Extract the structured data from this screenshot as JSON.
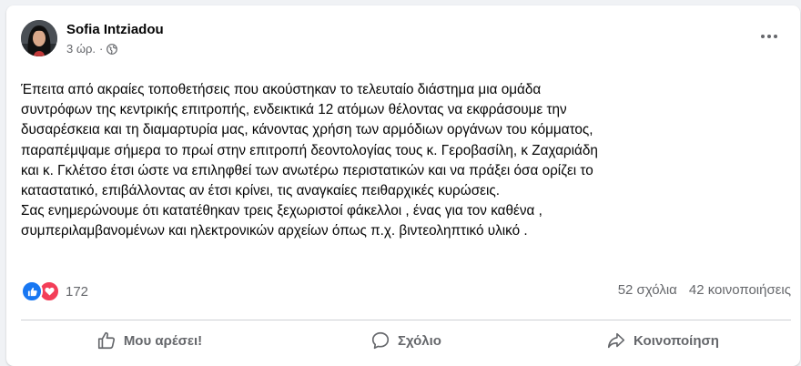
{
  "post": {
    "author": "Sofia Intziadou",
    "time": "3 ώρ.",
    "separator": "·",
    "audience_icon": "globe-icon",
    "body_lines": [
      "Έπειτα από ακραίες τοποθετήσεις που ακούστηκαν το τελευταίο διάστημα μια ομάδα",
      "συντρόφων της κεντρικής επιτροπής, ενδεικτικά 12 ατόμων θέλοντας να εκφράσουμε την",
      "δυσαρέσκεια και τη διαμαρτυρία μας, κάνοντας χρήση των αρμόδιων οργάνων του κόμματος,",
      "παραπέμψαμε σήμερα το πρωί στην επιτροπή δεοντολογίας τους κ. Γεροβασίλη, κ Ζαχαριάδη",
      "και κ. Γκλέτσο έτσι ώστε να επιληφθεί των ανωτέρω περιστατικών και να πράξει όσα ορίζει το",
      "καταστατικό, επιβάλλοντας αν έτσι κρίνει, τις αναγκαίες πειθαρχικές κυρώσεις.",
      "Σας ενημερώνουμε ότι κατατέθηκαν τρεις ξεχωριστοί φάκελλοι ,  ένας για τον καθένα ,",
      "συμπεριλαμβανομένων και ηλεκτρονικών αρχείων όπως π.χ. βιντεοληπτικό υλικό ."
    ]
  },
  "stats": {
    "reaction_count": "172",
    "comments": "52 σχόλια",
    "shares": "42 κοινοποιήσεις"
  },
  "actions": {
    "like": "Μου αρέσει!",
    "comment": "Σχόλιο",
    "share": "Κοινοποίηση"
  },
  "colors": {
    "like_blue": "#1877f2",
    "love_red": "#f33e58",
    "secondary_text": "#65676b"
  }
}
